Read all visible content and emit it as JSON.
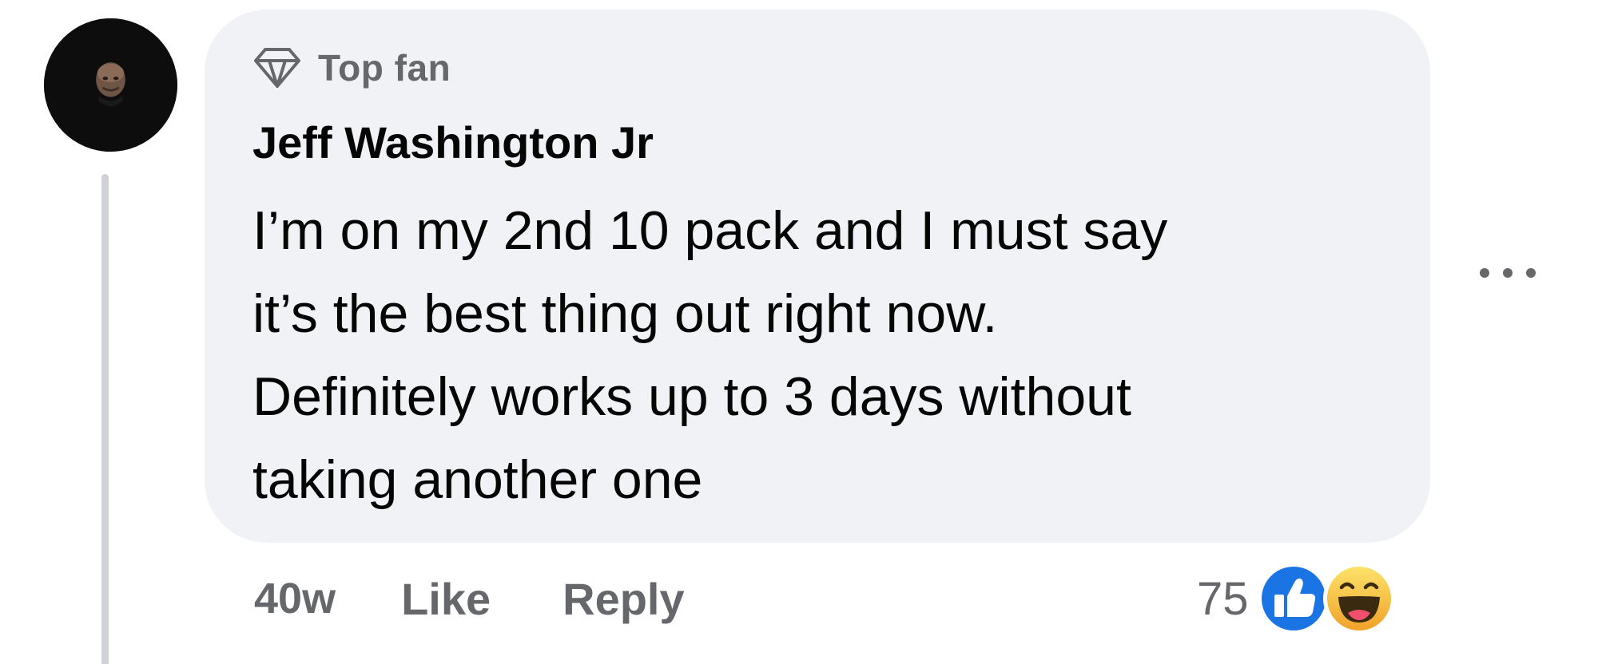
{
  "comment": {
    "badge": {
      "icon": "diamond-icon",
      "label": "Top fan"
    },
    "author": "Jeff Washington Jr",
    "text_lines": [
      "I’m on my 2nd 10 pack and I must say",
      "it’s the best thing out right now.",
      "Definitely works up to 3 days without",
      "taking another one"
    ],
    "timestamp": "40w",
    "actions": {
      "like_label": "Like",
      "reply_label": "Reply"
    },
    "reactions": {
      "count": "75",
      "types": [
        "like-icon",
        "haha-icon"
      ]
    },
    "more_icon": "ellipsis-icon"
  },
  "colors": {
    "bubble_bg": "#f0f2f5",
    "primary_text": "#050505",
    "secondary_text": "#65676b",
    "like_blue": "#1b74e4",
    "haha_yellow": "#f7b928"
  }
}
